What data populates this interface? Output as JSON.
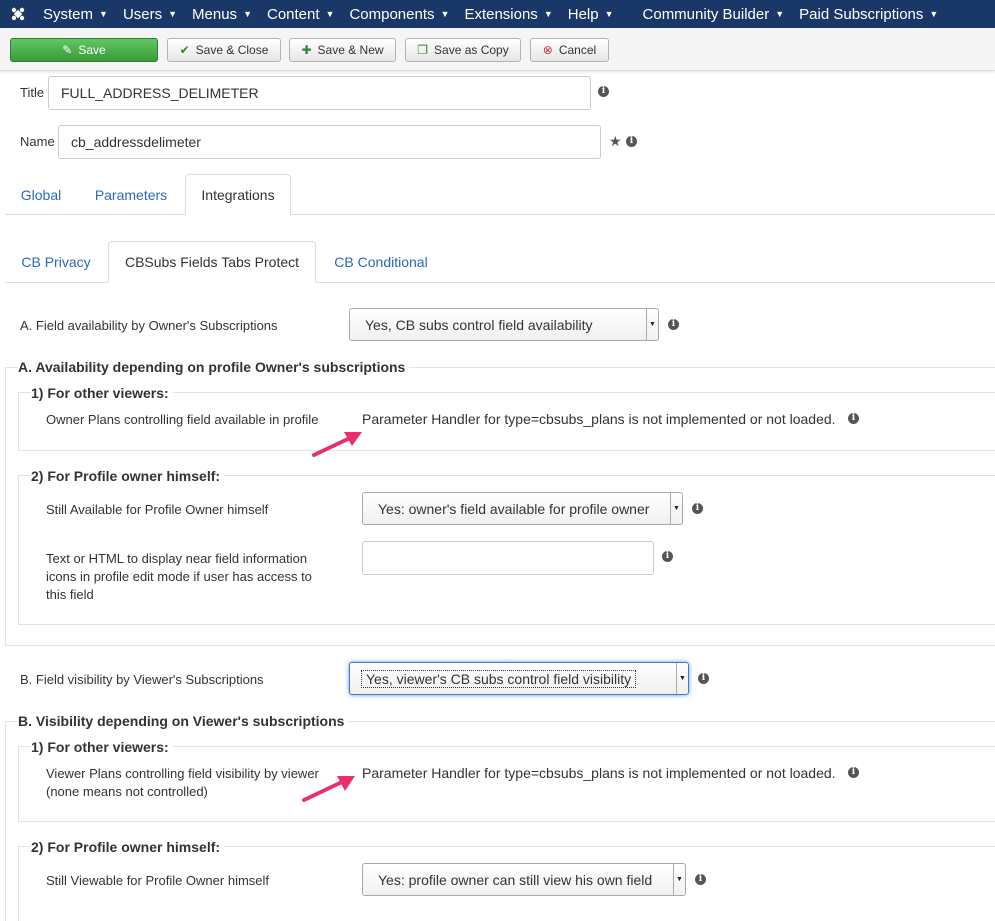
{
  "nav": {
    "items": [
      "System",
      "Users",
      "Menus",
      "Content",
      "Components",
      "Extensions",
      "Help",
      "Community Builder",
      "Paid Subscriptions"
    ]
  },
  "toolbar": {
    "save": "Save",
    "save_close": "Save & Close",
    "save_new": "Save & New",
    "save_copy": "Save as Copy",
    "cancel": "Cancel"
  },
  "form": {
    "title_label": "Title",
    "title_value": "FULL_ADDRESS_DELIMETER",
    "name_label": "Name",
    "name_value": "cb_addressdelimeter"
  },
  "tabs": [
    "Global",
    "Parameters",
    "Integrations"
  ],
  "subtabs": [
    "CB Privacy",
    "CBSubs Fields Tabs Protect",
    "CB Conditional"
  ],
  "sectionA": {
    "field_label": "A. Field availability by Owner's Subscriptions",
    "field_value": "Yes, CB subs control field availability",
    "legend": "A. Availability depending on profile Owner's subscriptions",
    "other_viewers": "1) For other viewers:",
    "owner_plans_label": "Owner Plans controlling field available in profile",
    "handler_msg": "Parameter Handler for type=cbsubs_plans is not implemented or not loaded.",
    "profile_owner": "2) For Profile owner himself:",
    "still_available_label": "Still Available for Profile Owner himself",
    "still_available_value": "Yes: owner's field available for profile owner",
    "text_html_label_1": "Text or HTML to display near field information",
    "text_html_label_2": "icons in profile edit mode if user has access to",
    "text_html_label_3": "this field",
    "text_html_value": ""
  },
  "sectionB": {
    "field_label": "B. Field visibility by Viewer's Subscriptions",
    "field_value": "Yes, viewer's CB subs control field visibility",
    "legend": "B. Visibility depending on Viewer's subscriptions",
    "other_viewers": "1) For other viewers:",
    "viewer_plans_label_1": "Viewer Plans controlling field visibility by viewer",
    "viewer_plans_label_2": "(none means not controlled)",
    "handler_msg": "Parameter Handler for type=cbsubs_plans is not implemented or not loaded.",
    "profile_owner": "2) For Profile owner himself:",
    "still_viewable_label": "Still Viewable for Profile Owner himself",
    "still_viewable_value": "Yes: profile owner can still view his own field"
  },
  "colors": {
    "navbar": "#1a3867",
    "save_green": "#46a546",
    "link_blue": "#2a69b8",
    "annotation_arrow": "#e8306f"
  }
}
